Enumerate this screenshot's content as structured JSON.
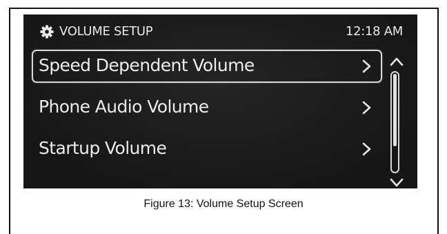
{
  "screen": {
    "title": "VOLUME SETUP",
    "title_icon": "gear-icon",
    "clock": "12:18 AM",
    "background_color": "#1a1a1a",
    "text_color": "#ececec"
  },
  "menu": {
    "items": [
      {
        "label": "Speed Dependent Volume",
        "icon": "chevron-right-icon",
        "selected": true
      },
      {
        "label": "Phone Audio Volume",
        "icon": "chevron-right-icon",
        "selected": false
      },
      {
        "label": "Startup Volume",
        "icon": "chevron-right-icon",
        "selected": false
      }
    ]
  },
  "scrollbar": {
    "up_icon": "chevron-up-icon",
    "down_icon": "chevron-down-icon",
    "visible_fraction": 0.75,
    "position_fraction": 0.0
  },
  "caption": "Figure 13: Volume Setup Screen"
}
